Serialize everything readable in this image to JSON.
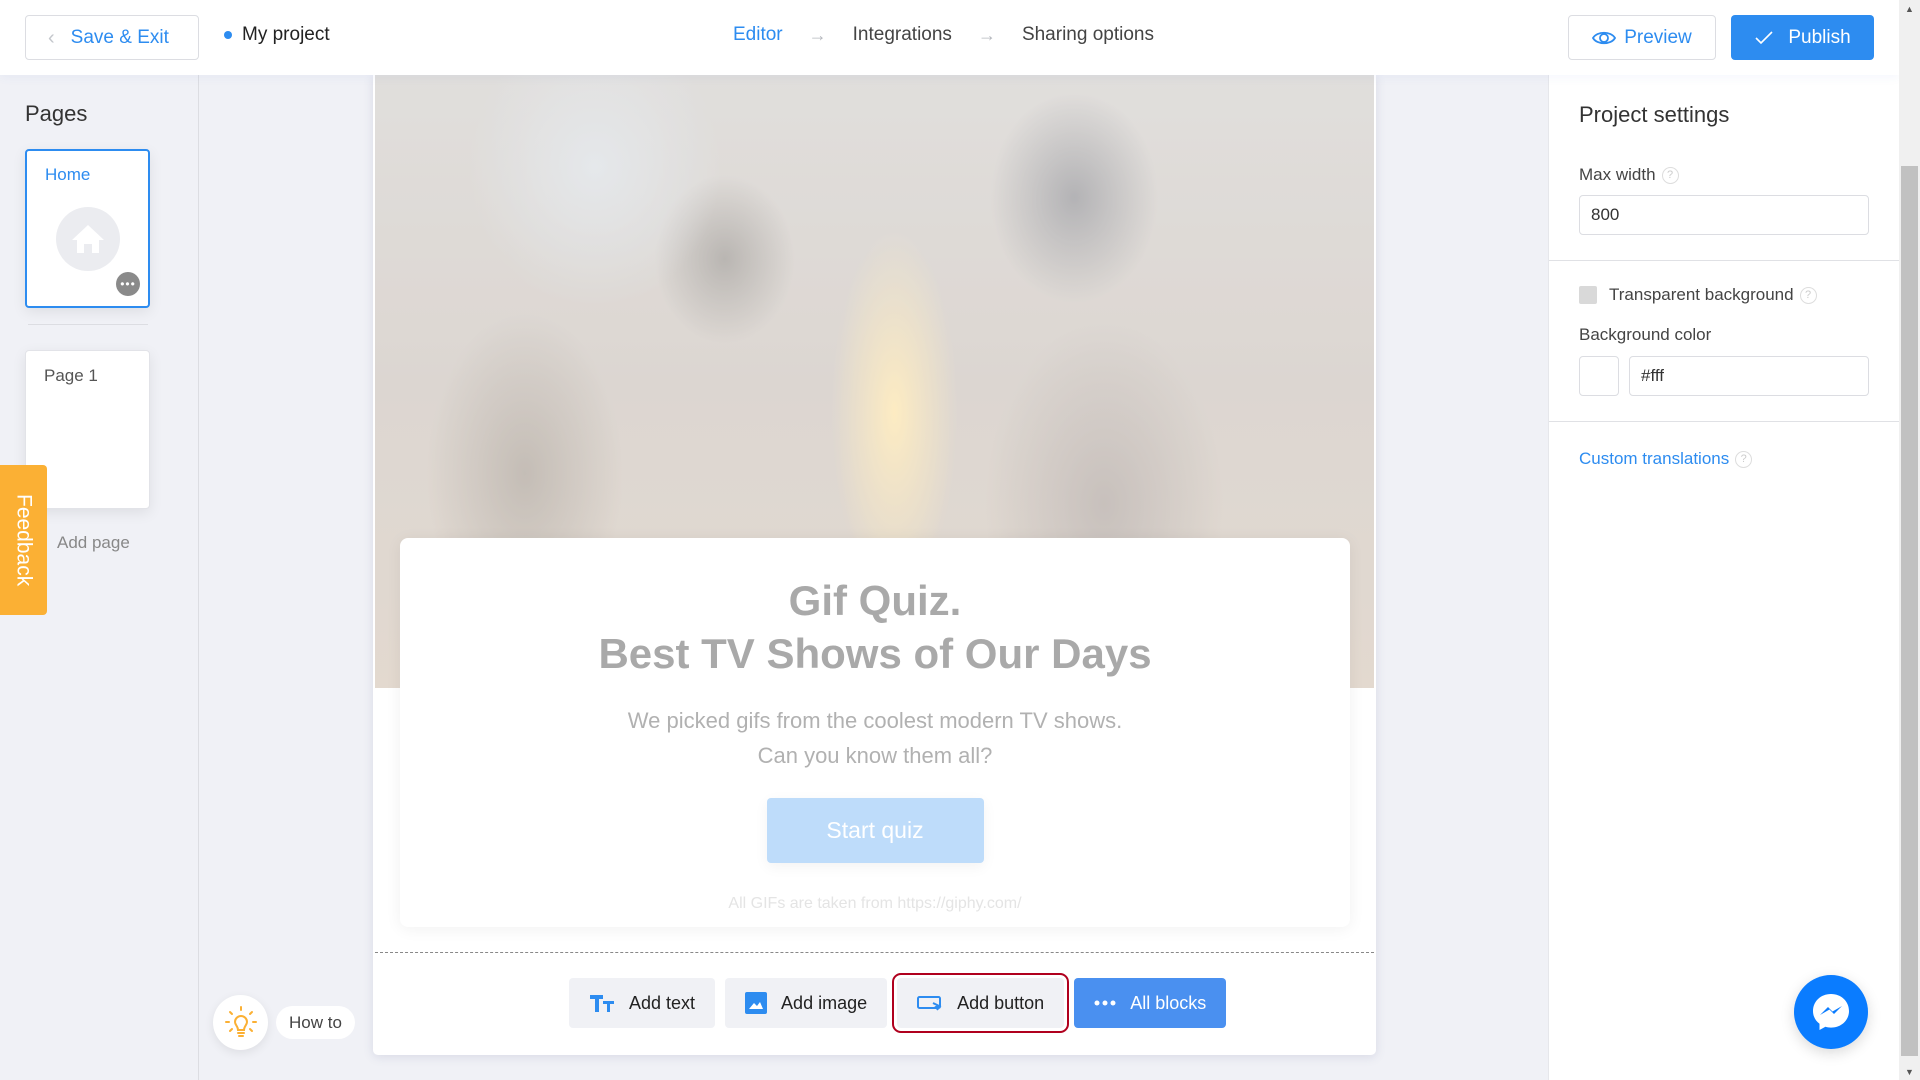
{
  "header": {
    "save_exit_label": "Save & Exit",
    "project_name": "My project",
    "steps": [
      {
        "label": "Editor",
        "active": true
      },
      {
        "label": "Integrations",
        "active": false
      },
      {
        "label": "Sharing options",
        "active": false
      }
    ],
    "preview_label": "Preview",
    "publish_label": "Publish"
  },
  "sidebar": {
    "title": "Pages",
    "pages": [
      {
        "label": "Home",
        "selected": true,
        "icon": "home-icon"
      },
      {
        "label": "Page 1",
        "selected": false
      }
    ],
    "add_page_label": "Add page",
    "feedback_label": "Feedback",
    "how_to_label": "How to"
  },
  "canvas": {
    "quiz_title_line1": "Gif Quiz.",
    "quiz_title_line2": "Best TV Shows of Our Days",
    "quiz_desc_line1": "We picked gifs from the coolest modern TV shows.",
    "quiz_desc_line2": "Can you know them all?",
    "start_button_label": "Start quiz",
    "credit_text": "All GIFs are taken from https://giphy.com/"
  },
  "toolbar": {
    "add_text_label": "Add text",
    "add_image_label": "Add image",
    "add_button_label": "Add button",
    "all_blocks_label": "All blocks"
  },
  "settings": {
    "title": "Project settings",
    "max_width_label": "Max width",
    "max_width_value": "800",
    "transparent_bg_label": "Transparent background",
    "transparent_bg_checked": false,
    "bg_color_label": "Background color",
    "bg_color_value": "#fff",
    "custom_translations_label": "Custom translations",
    "help_glyph": "?"
  },
  "colors": {
    "accent": "#2d8cf0",
    "feedback": "#fbb034",
    "messenger": "#0a7cff",
    "highlight_outline": "#b0001e"
  }
}
